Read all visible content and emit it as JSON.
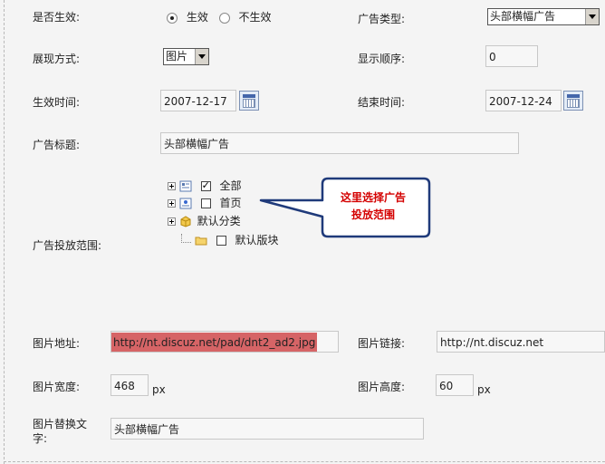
{
  "colors": {
    "callout_border": "#1f3a7a",
    "callout_text": "#d40000",
    "url_highlight": "#d66466"
  },
  "row1": {
    "enable_label": "是否生效:",
    "radio_on": "生效",
    "radio_off": "不生效",
    "ad_type_label": "广告类型:",
    "ad_type_value": "头部横幅广告"
  },
  "row2": {
    "display_label": "展现方式:",
    "display_value": "图片",
    "order_label": "显示顺序:",
    "order_value": "0"
  },
  "row3": {
    "start_label": "生效时间:",
    "start_value": "2007-12-17",
    "end_label": "结束时间:",
    "end_value": "2007-12-24"
  },
  "row4": {
    "title_label": "广告标题:",
    "title_value": "头部横幅广告"
  },
  "scope": {
    "label": "广告投放范围:",
    "tree": {
      "all": "全部",
      "home": "首页",
      "default_category": "默认分类",
      "default_board": "默认版块"
    },
    "callout_line1": "这里选择广告",
    "callout_line2": "投放范围"
  },
  "image": {
    "url_label": "图片地址:",
    "url_value": "http://nt.discuz.net/pad/dnt2_ad2.jpg",
    "link_label": "图片链接:",
    "link_value": "http://nt.discuz.net",
    "width_label": "图片宽度:",
    "width_value": "468",
    "width_unit": "px",
    "height_label": "图片高度:",
    "height_value": "60",
    "height_unit": "px",
    "alt_label_line1": "图片替换文",
    "alt_label_line2": "字:",
    "alt_value": "头部横幅广告"
  },
  "icons": [
    "calendar-icon",
    "checkbox-icon",
    "tree-expander-icon",
    "folder-icon",
    "page-icon",
    "box-icon"
  ]
}
